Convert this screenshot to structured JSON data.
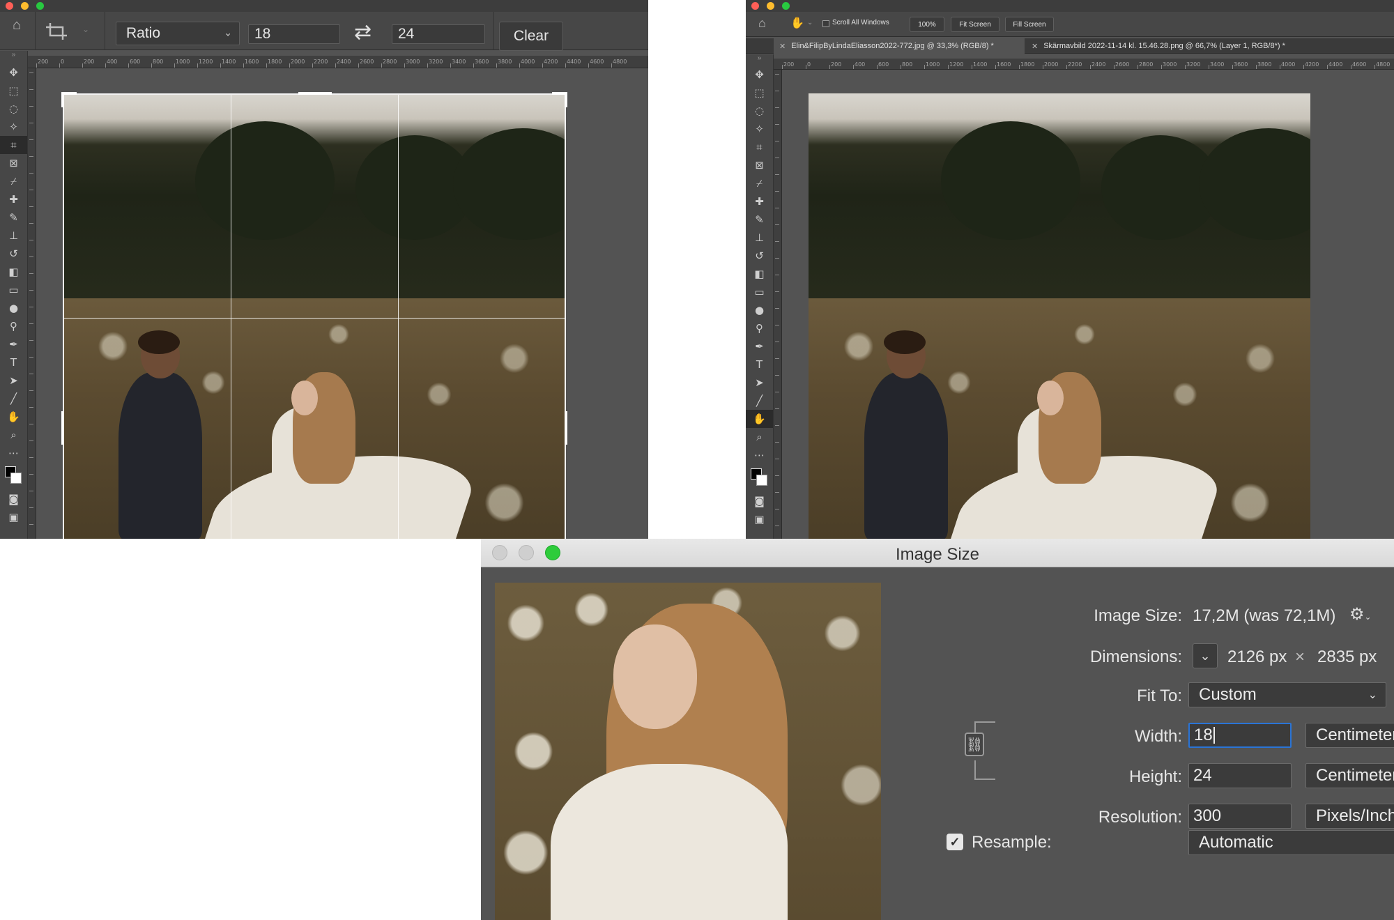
{
  "left_window": {
    "options_bar": {
      "ratio_label": "Ratio",
      "width_value": "18",
      "height_value": "24",
      "clear_label": "Clear"
    },
    "ruler_ticks": [
      "200",
      "0",
      "200",
      "400",
      "600",
      "800",
      "1000",
      "1200",
      "1400",
      "1600",
      "1800",
      "2000",
      "2200",
      "2400",
      "2600",
      "2800",
      "3000",
      "3200",
      "3400",
      "3600",
      "3800",
      "4000",
      "4200",
      "4400",
      "4600",
      "4800"
    ]
  },
  "right_window": {
    "options_bar": {
      "scroll_all_label": "Scroll All Windows",
      "zoom_label": "100%",
      "fit_screen_label": "Fit Screen",
      "fill_screen_label": "Fill Screen"
    },
    "tabs": [
      {
        "label": "Elin&FilipByLindaEliasson2022-772.jpg @ 33,3% (RGB/8) *"
      },
      {
        "label": "Skärmavbild 2022-11-14 kl. 15.46.28.png @ 66,7% (Layer 1, RGB/8*) *"
      }
    ],
    "ruler_ticks": [
      "200",
      "0",
      "200",
      "400",
      "600",
      "800",
      "1000",
      "1200",
      "1400",
      "1600",
      "1800",
      "2000",
      "2200",
      "2400",
      "2600",
      "2800",
      "3000",
      "3200",
      "3400",
      "3600",
      "3800",
      "4000",
      "4200",
      "4400",
      "4600",
      "4800"
    ]
  },
  "dialog": {
    "title": "Image Size",
    "image_size_label": "Image Size:",
    "image_size_value": "17,2M (was 72,1M)",
    "dimensions_label": "Dimensions:",
    "dimensions_width": "2126 px",
    "dimensions_times": "×",
    "dimensions_height": "2835 px",
    "fit_to_label": "Fit To:",
    "fit_to_value": "Custom",
    "width_label": "Width:",
    "width_value": "18",
    "width_unit": "Centimeters",
    "height_label": "Height:",
    "height_value": "24",
    "height_unit": "Centimeters",
    "resolution_label": "Resolution:",
    "resolution_value": "300",
    "resolution_unit": "Pixels/Inch",
    "resample_label": "Resample:",
    "resample_checked": true,
    "resample_value": "Automatic"
  },
  "icons": {
    "left_tools": [
      "move-icon",
      "marquee-icon",
      "lasso-icon",
      "magic-wand-icon",
      "crop-icon",
      "frame-icon",
      "eyedropper-icon",
      "healing-brush-icon",
      "brush-icon",
      "stamp-icon",
      "history-brush-icon",
      "eraser-icon",
      "gradient-icon",
      "blur-icon",
      "dodge-icon",
      "pen-icon",
      "type-icon",
      "path-select-icon",
      "line-icon",
      "hand-icon",
      "zoom-icon",
      "more-tools-icon"
    ]
  },
  "colors": {
    "app_bg": "#535353",
    "panel": "#474747",
    "accent_blue": "#2a74d6",
    "traffic_green": "#2ecc3b"
  }
}
